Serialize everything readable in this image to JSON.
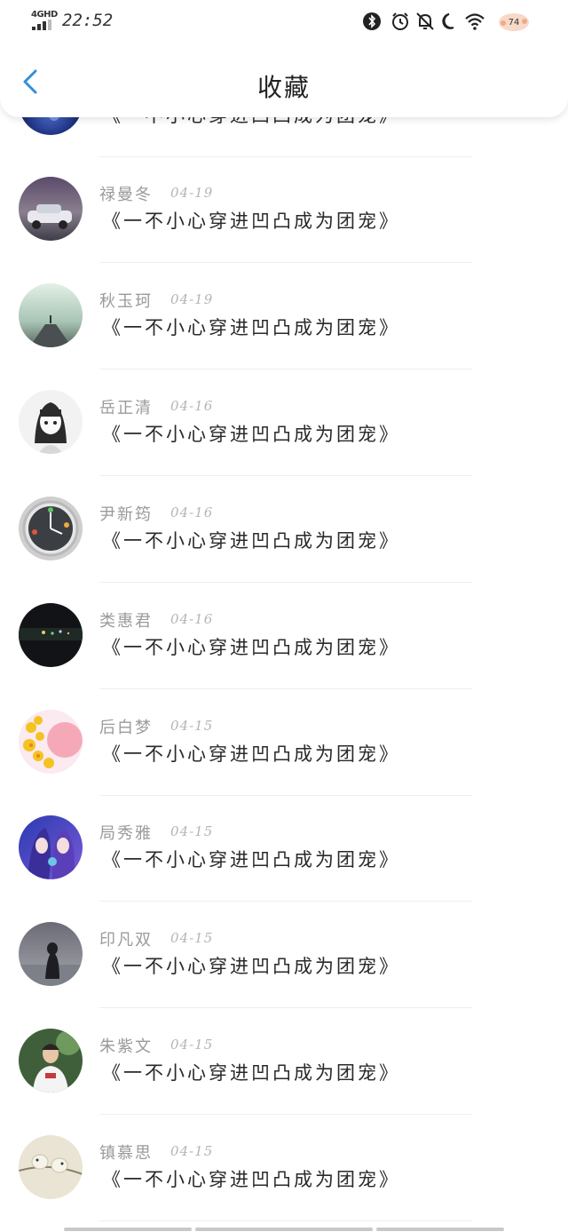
{
  "status_bar": {
    "network": "4GHD",
    "time": "22:52",
    "battery_badge": "74",
    "icons": [
      "signal-icon",
      "bluetooth-icon",
      "alarm-icon",
      "mute-icon",
      "moon-icon",
      "wifi-icon"
    ]
  },
  "header": {
    "title": "收藏",
    "back_icon": "chevron-left-icon",
    "accent_color": "#2f8fe0"
  },
  "favorites": [
    {
      "author": "",
      "date": "",
      "book": "《一不小心穿进凹凸成为团宠》",
      "avatar": "galaxy"
    },
    {
      "author": "禄曼冬",
      "date": "04-19",
      "book": "《一不小心穿进凹凸成为团宠》",
      "avatar": "car"
    },
    {
      "author": "秋玉珂",
      "date": "04-19",
      "book": "《一不小心穿进凹凸成为团宠》",
      "avatar": "misty-pier"
    },
    {
      "author": "岳正清",
      "date": "04-16",
      "book": "《一不小心穿进凹凸成为团宠》",
      "avatar": "sketch-girl"
    },
    {
      "author": "尹新筠",
      "date": "04-16",
      "book": "《一不小心穿进凹凸成为团宠》",
      "avatar": "clock"
    },
    {
      "author": "类惠君",
      "date": "04-16",
      "book": "《一不小心穿进凹凸成为团宠》",
      "avatar": "night-lights"
    },
    {
      "author": "后白梦",
      "date": "04-15",
      "book": "《一不小心穿进凹凸成为团宠》",
      "avatar": "flowers"
    },
    {
      "author": "局秀雅",
      "date": "04-15",
      "book": "《一不小心穿进凹凸成为团宠》",
      "avatar": "anime-pair"
    },
    {
      "author": "印凡双",
      "date": "04-15",
      "book": "《一不小心穿进凹凸成为团宠》",
      "avatar": "sea-girl"
    },
    {
      "author": "朱紫文",
      "date": "04-15",
      "book": "《一不小心穿进凹凸成为团宠》",
      "avatar": "boy"
    },
    {
      "author": "镇慕思",
      "date": "04-15",
      "book": "《一不小心穿进凹凸成为团宠》",
      "avatar": "birds"
    }
  ]
}
